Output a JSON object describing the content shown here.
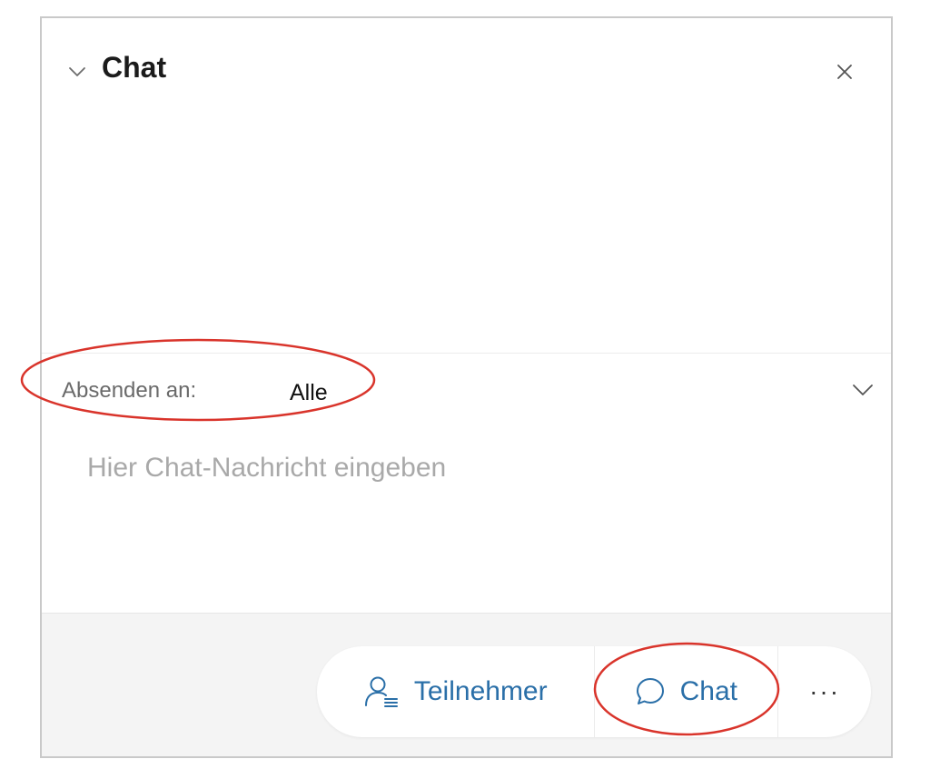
{
  "chat_panel": {
    "title": "Chat",
    "collapse_icon": "chevron-down-icon",
    "close_icon": "close-icon"
  },
  "send_to": {
    "label": "Absenden an:",
    "value": "Alle",
    "dropdown_icon": "chevron-down-icon"
  },
  "message_input": {
    "value": "",
    "placeholder": "Hier Chat-Nachricht eingeben"
  },
  "toolbar": {
    "participants": {
      "label": "Teilnehmer",
      "icon": "participants-icon"
    },
    "chat": {
      "label": "Chat",
      "icon": "chat-bubble-icon"
    },
    "more": {
      "icon": "more-icon",
      "glyph": "···"
    }
  },
  "colors": {
    "accent_blue": "#2a6fa8",
    "annotation_red": "#d9342b",
    "footer_bg": "#f4f4f4",
    "panel_border": "#c9c9c9"
  }
}
